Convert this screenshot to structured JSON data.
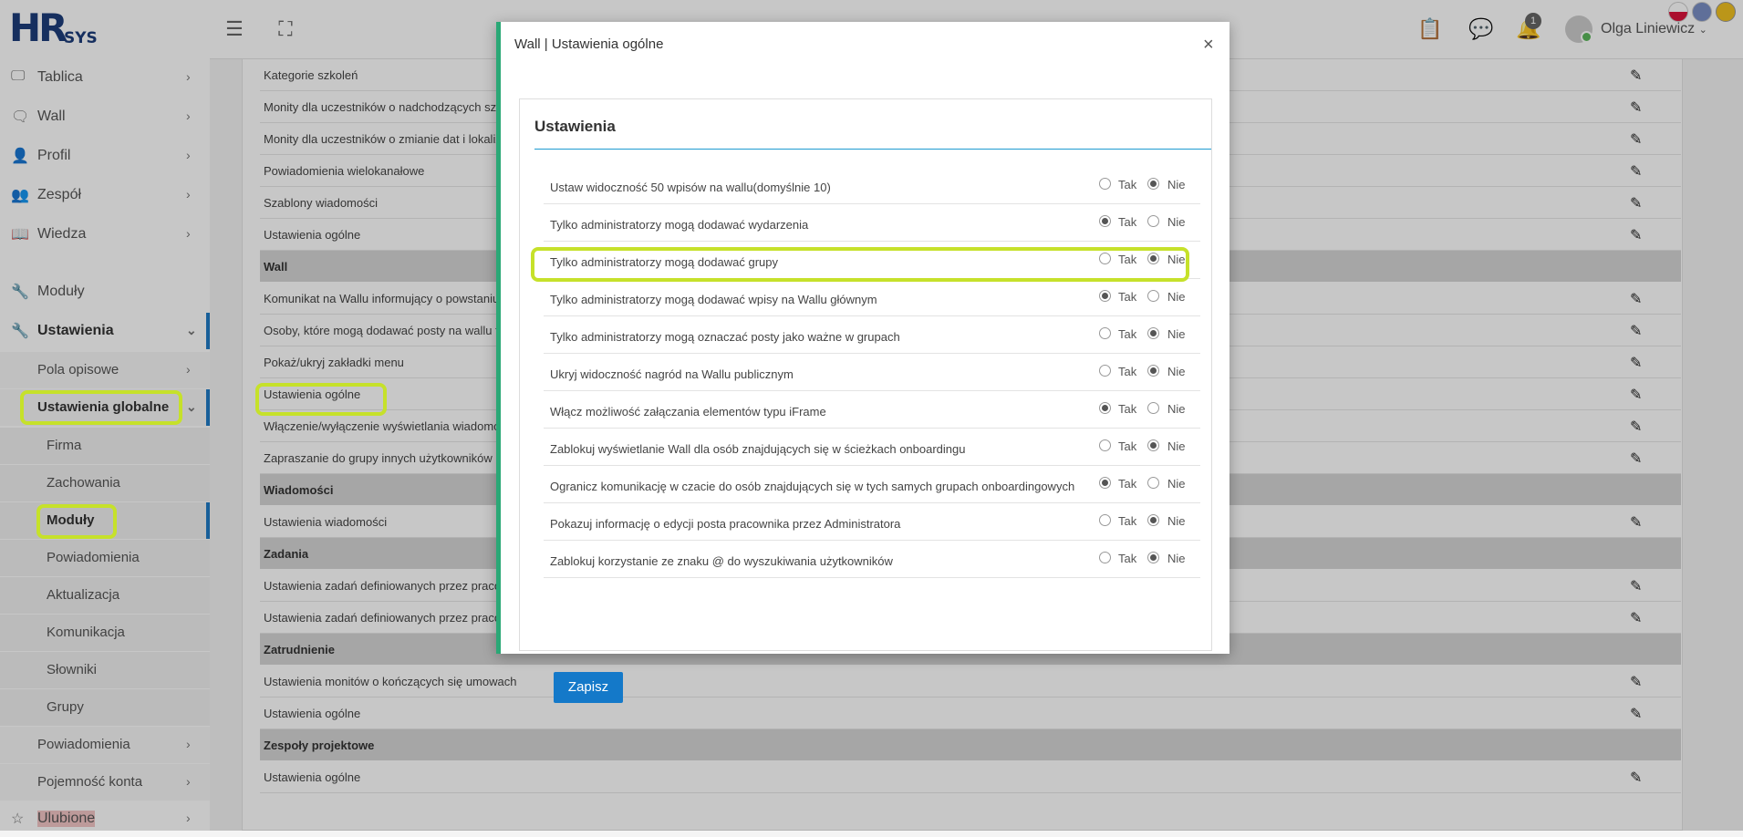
{
  "header": {
    "logo_main": "HR",
    "logo_sub": "SYS",
    "user_name": "Olga Liniewicz",
    "notification_count": "1"
  },
  "sidebar": {
    "items": [
      {
        "label": "Tablica",
        "icon": "monitor-icon"
      },
      {
        "label": "Wall",
        "icon": "chat-icon"
      },
      {
        "label": "Profil",
        "icon": "user-icon"
      },
      {
        "label": "Zespół",
        "icon": "team-icon"
      },
      {
        "label": "Wiedza",
        "icon": "book-icon"
      },
      {
        "label": "Moduły",
        "icon": "wrench-icon"
      },
      {
        "label": "Ustawienia",
        "icon": "wrench-icon"
      }
    ],
    "sub_pola": "Pola opisowe",
    "sub_globalne": "Ustawienia globalne",
    "sub2": [
      "Firma",
      "Zachowania",
      "Moduły",
      "Powiadomienia",
      "Aktualizacja",
      "Komunikacja",
      "Słowniki",
      "Grupy"
    ],
    "sub_powiadomienia": "Powiadomienia",
    "sub_pojemnosc": "Pojemność konta",
    "ulubione": "Ulubione"
  },
  "main": {
    "rows": [
      {
        "type": "row",
        "text": "Kategorie szkoleń"
      },
      {
        "type": "row",
        "text": "Monity dla uczestników o nadchodzących szko"
      },
      {
        "type": "row",
        "text": "Monity dla uczestników o zmianie dat i lokaliz"
      },
      {
        "type": "row",
        "text": "Powiadomienia wielokanałowe"
      },
      {
        "type": "row",
        "text": "Szablony wiadomości"
      },
      {
        "type": "row",
        "text": "Ustawienia ogólne"
      },
      {
        "type": "sec",
        "text": "Wall"
      },
      {
        "type": "row",
        "text": "Komunikat na Wallu informujący o powstaniu"
      },
      {
        "type": "row",
        "text": "Osoby, które mogą dodawać posty na wallu fir"
      },
      {
        "type": "row",
        "text": "Pokaż/ukryj zakładki menu"
      },
      {
        "type": "row",
        "text": "Ustawienia ogólne"
      },
      {
        "type": "row",
        "text": "Włączenie/wyłączenie wyświetlania wiadomoś"
      },
      {
        "type": "row",
        "text": "Zapraszanie do grupy innych użytkowników pr"
      },
      {
        "type": "sec",
        "text": "Wiadomości"
      },
      {
        "type": "row",
        "text": "Ustawienia wiadomości"
      },
      {
        "type": "sec",
        "text": "Zadania"
      },
      {
        "type": "row",
        "text": "Ustawienia zadań definiowanych przez pracov"
      },
      {
        "type": "row",
        "text": "Ustawienia zadań definiowanych przez pracov"
      },
      {
        "type": "sec",
        "text": "Zatrudnienie"
      },
      {
        "type": "row",
        "text": "Ustawienia monitów o kończących się umowach"
      },
      {
        "type": "row",
        "text": "Ustawienia ogólne"
      },
      {
        "type": "sec",
        "text": "Zespoły projektowe"
      },
      {
        "type": "row",
        "text": "Ustawienia ogólne"
      }
    ]
  },
  "modal": {
    "title": "Wall | Ustawienia ogólne",
    "close": "×",
    "panel_title": "Ustawienia",
    "yes_label": "Tak",
    "no_label": "Nie",
    "save_label": "Zapisz",
    "settings": [
      {
        "label": "Ustaw widoczność 50 wpisów na wallu(domyślnie 10)",
        "value": "Nie"
      },
      {
        "label": "Tylko administratorzy mogą dodawać wydarzenia",
        "value": "Tak"
      },
      {
        "label": "Tylko administratorzy mogą dodawać grupy",
        "value": "Nie"
      },
      {
        "label": "Tylko administratorzy mogą dodawać wpisy na Wallu głównym",
        "value": "Tak"
      },
      {
        "label": "Tylko administratorzy mogą oznaczać posty jako ważne w grupach",
        "value": "Nie"
      },
      {
        "label": "Ukryj widoczność nagród na Wallu publicznym",
        "value": "Nie"
      },
      {
        "label": "Włącz możliwość załączania elementów typu iFrame",
        "value": "Tak"
      },
      {
        "label": "Zablokuj wyświetlanie Wall dla osób znajdujących się w ścieżkach onboardingu",
        "value": "Nie"
      },
      {
        "label": "Ogranicz komunikację w czacie do osób znajdujących się w tych samych grupach onboardingowych",
        "value": "Tak"
      },
      {
        "label": "Pokazuj informację o edycji posta pracownika przez Administratora",
        "value": "Nie"
      },
      {
        "label": "Zablokuj korzystanie ze znaku @ do wyszukiwania użytkowników",
        "value": "Nie"
      }
    ]
  },
  "colors": {
    "accent": "#1479c9",
    "modal_border": "#2aa876",
    "highlight": "#c6e12a"
  }
}
